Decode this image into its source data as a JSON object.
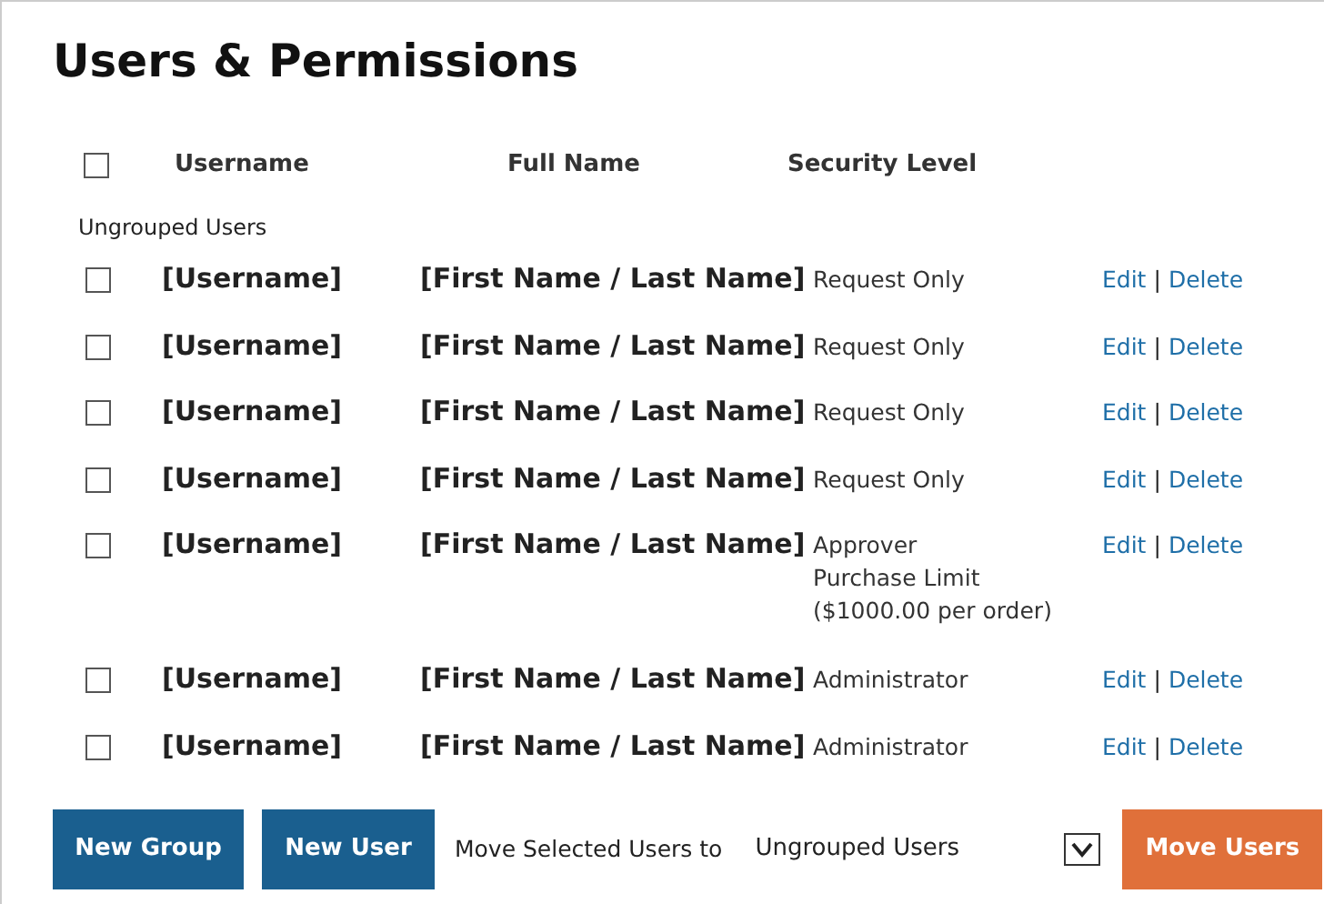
{
  "title": "Users & Permissions",
  "header": {
    "select_all": {
      "checked": false
    },
    "columns": [
      "Username",
      "Full Name",
      "Security Level"
    ]
  },
  "group_label": "Ungrouped Users",
  "rows": [
    {
      "checked": false,
      "username": "[Username]",
      "full_name": "[First Name / Last Name]",
      "security": [
        "Request Only"
      ],
      "edit": "Edit",
      "separator": "|",
      "delete": "Delete"
    },
    {
      "checked": false,
      "username": "[Username]",
      "full_name": "[First Name / Last Name]",
      "security": [
        "Request Only"
      ],
      "edit": "Edit",
      "separator": "|",
      "delete": "Delete"
    },
    {
      "checked": false,
      "username": "[Username]",
      "full_name": "[First Name / Last Name]",
      "security": [
        "Request Only"
      ],
      "edit": "Edit",
      "separator": "|",
      "delete": "Delete"
    },
    {
      "checked": false,
      "username": "[Username]",
      "full_name": "[First Name / Last Name]",
      "security": [
        "Request Only"
      ],
      "edit": "Edit",
      "separator": "|",
      "delete": "Delete"
    },
    {
      "checked": false,
      "username": "[Username]",
      "full_name": "[First Name / Last Name]",
      "security": [
        "Approver",
        "Purchase Limit",
        "($1000.00 per order)"
      ],
      "edit": "Edit",
      "separator": "|",
      "delete": "Delete"
    },
    {
      "checked": false,
      "username": "[Username]",
      "full_name": "[First Name / Last Name]",
      "security": [
        "Administrator"
      ],
      "edit": "Edit",
      "separator": "|",
      "delete": "Delete"
    },
    {
      "checked": false,
      "username": "[Username]",
      "full_name": "[First Name / Last Name]",
      "security": [
        "Administrator"
      ],
      "edit": "Edit",
      "separator": "|",
      "delete": "Delete"
    }
  ],
  "footer": {
    "new_group": "New Group",
    "new_user": "New User",
    "move_label": "Move Selected Users to",
    "target": "Ungrouped Users",
    "move_button": "Move Users"
  }
}
